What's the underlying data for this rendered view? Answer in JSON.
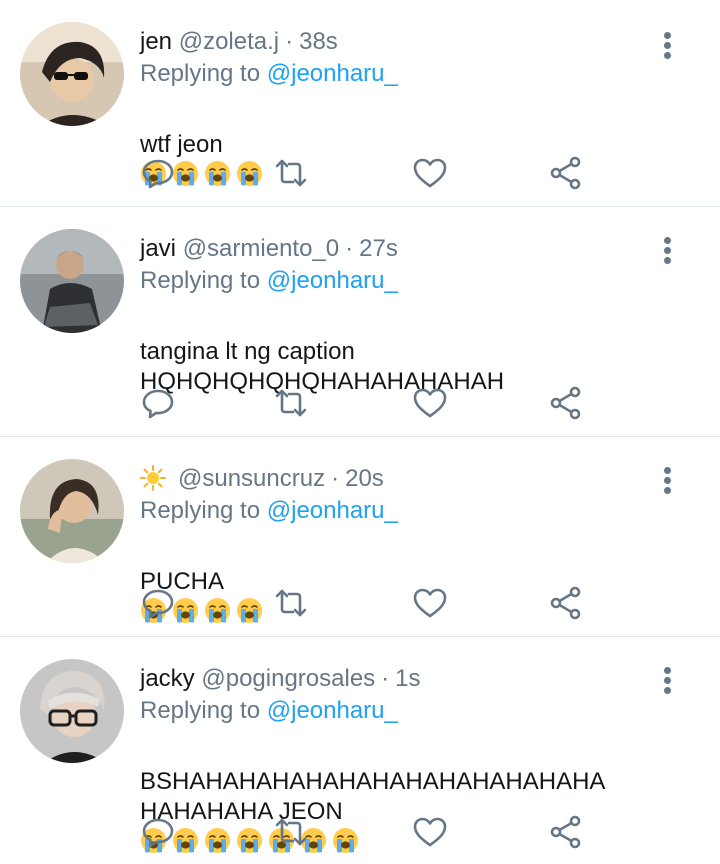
{
  "replies": [
    {
      "name": "jen",
      "handle": "@zoleta.j",
      "time": "38s",
      "replying_prefix": "Replying to",
      "replying_to": "@jeonharu_",
      "text": "wtf jeon",
      "emoji_count": 4,
      "avatar_colors": [
        "#c8b39a",
        "#2b2420",
        "#e9dccb"
      ]
    },
    {
      "name": "javi",
      "handle": "@sarmiento_0",
      "time": "27s",
      "replying_prefix": "Replying to",
      "replying_to": "@jeonharu_",
      "text": "tangina lt ng caption\nHQHQHQHQHQHAHAHAHAHAH",
      "emoji_count": 0,
      "avatar_colors": [
        "#8a8f93",
        "#2d2f33",
        "#5d6064"
      ]
    },
    {
      "name": "",
      "handle": "@sunsuncruz",
      "time": "20s",
      "replying_prefix": "Replying to",
      "replying_to": "@jeonharu_",
      "text": "PUCHA",
      "emoji_count": 4,
      "avatar_colors": [
        "#c9c2b3",
        "#3a2d24",
        "#efe7db"
      ]
    },
    {
      "name": "jacky",
      "handle": "@pogingrosales",
      "time": "1s",
      "replying_prefix": "Replying to",
      "replying_to": "@jeonharu_",
      "text": "BSHAHAHAHAHAHAHAHAHAHAHAHAHA\nHAHAHAHA JEON",
      "emoji_count": 7,
      "avatar_colors": [
        "#b8b8b8",
        "#1f1f1f",
        "#d9d4cf"
      ]
    }
  ],
  "icons": {
    "reply": "reply-icon",
    "retweet": "retweet-icon",
    "like": "like-icon",
    "share": "share-icon",
    "more": "more-vertical-icon",
    "emoji": "loudly-crying-face-emoji",
    "sun": "sun-icon"
  },
  "colors": {
    "secondary_text": "#657786",
    "mention": "#1da1f2",
    "divider": "#e1e8ed"
  }
}
